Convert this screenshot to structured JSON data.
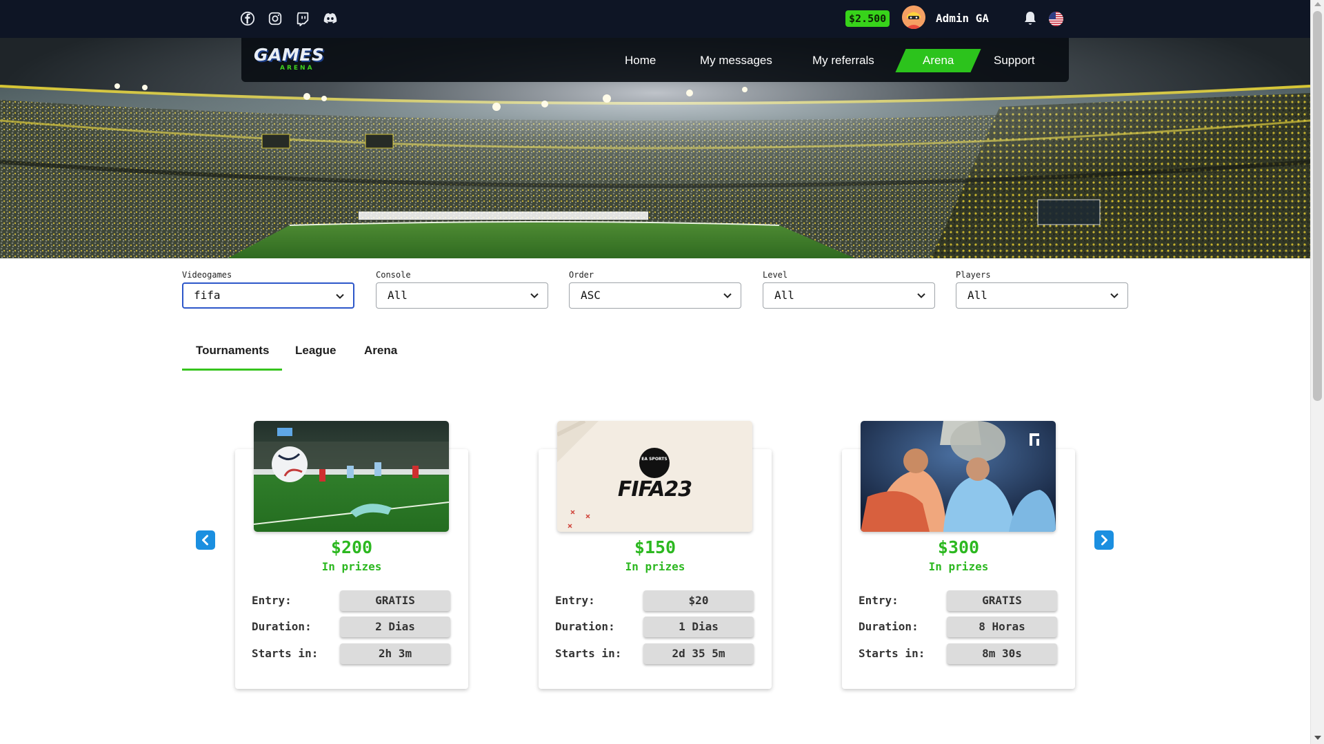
{
  "topbar": {
    "social_icons": [
      "facebook-icon",
      "instagram-icon",
      "twitch-icon",
      "discord-icon"
    ],
    "balance": "$2.500",
    "username": "Admin GA",
    "notification_icon": "bell-icon",
    "language_flag": "us-flag-icon"
  },
  "brand": {
    "logo_main": "GAMES",
    "logo_sub": "ARENA",
    "accent_color": "#2cc31c"
  },
  "nav": {
    "items": [
      {
        "label": "Home",
        "active": false
      },
      {
        "label": "My messages",
        "active": false
      },
      {
        "label": "My referrals",
        "active": false
      },
      {
        "label": "Arena",
        "active": true
      },
      {
        "label": "Support",
        "active": false
      }
    ]
  },
  "filters": [
    {
      "label": "Videogames",
      "value": "fifa"
    },
    {
      "label": "Console",
      "value": "All"
    },
    {
      "label": "Order",
      "value": "ASC"
    },
    {
      "label": "Level",
      "value": "All"
    },
    {
      "label": "Players",
      "value": "All"
    }
  ],
  "tabs": [
    {
      "label": "Tournaments",
      "active": true
    },
    {
      "label": "League",
      "active": false
    },
    {
      "label": "Arena",
      "active": false
    }
  ],
  "cards": [
    {
      "image": "football-match-image",
      "prize": "$200",
      "prize_caption": "In prizes",
      "rows": [
        {
          "key": "Entry:",
          "value": "GRATIS"
        },
        {
          "key": "Duration:",
          "value": "2 Dias"
        },
        {
          "key": "Starts in:",
          "value": "2h 3m"
        }
      ]
    },
    {
      "image": "fifa23-cover-image",
      "image_text": "FIFA23",
      "image_badge": "EA SPORTS",
      "prize": "$150",
      "prize_caption": "In prizes",
      "rows": [
        {
          "key": "Entry:",
          "value": "$20"
        },
        {
          "key": "Duration:",
          "value": "1 Dias"
        },
        {
          "key": "Starts in:",
          "value": "2d 35 5m"
        }
      ]
    },
    {
      "image": "trophy-celebration-image",
      "prize": "$300",
      "prize_caption": "In prizes",
      "rows": [
        {
          "key": "Entry:",
          "value": "GRATIS"
        },
        {
          "key": "Duration:",
          "value": "8 Horas"
        },
        {
          "key": "Starts in:",
          "value": "8m 30s"
        }
      ]
    }
  ],
  "carousel": {
    "prev_icon": "chevron-left-icon",
    "next_icon": "chevron-right-icon"
  }
}
